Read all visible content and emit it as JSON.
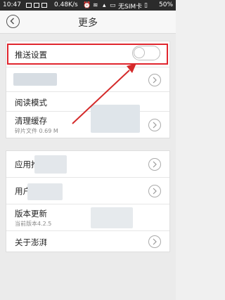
{
  "status_bar": {
    "time": "10:47",
    "speed": "0.48K/s",
    "carrier": "无SIM卡",
    "battery": "50%"
  },
  "header": {
    "title": "更多"
  },
  "settings": {
    "push": {
      "label": "推送设置",
      "enabled": false
    },
    "reading_mode": {
      "label": "阅读模式"
    },
    "clear_cache": {
      "label": "清理缓存",
      "sub": "碎片文件 0.69 M"
    },
    "app_recommend": {
      "label": "应用推荐"
    },
    "user_feedback": {
      "label": "用户反馈"
    },
    "version_update": {
      "label": "版本更新",
      "sub": "当前版本4.2.5"
    },
    "about": {
      "label": "关于澎湃"
    }
  },
  "colors": {
    "highlight": "#e0262e",
    "arrow": "#d42a2a"
  }
}
